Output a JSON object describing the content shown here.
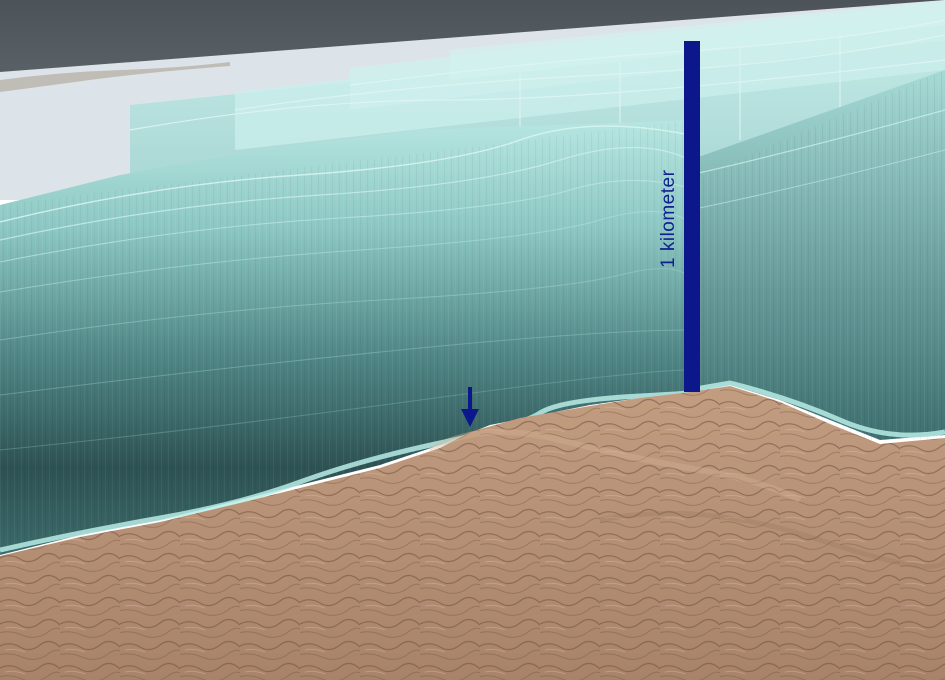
{
  "scale_bar": {
    "label": "1 kilometer"
  },
  "colors": {
    "sky_dark": "#4f565c",
    "sky_light": "#dfe5ea",
    "ice_light": "#a9ddd8",
    "ice_mid": "#6fa9a8",
    "ice_dark": "#2c4c4d",
    "bedrock": "#b48e73",
    "bedrock_dark": "#8a6b55",
    "marker_blue": "#0d178c"
  },
  "icons": {
    "scale_bar": "vertical-bar",
    "marker": "down-arrow-icon"
  }
}
